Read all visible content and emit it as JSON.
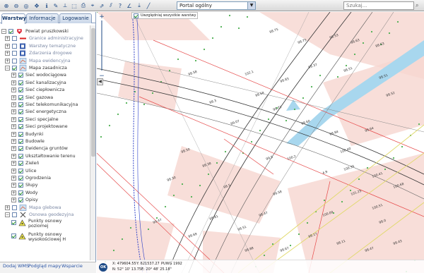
{
  "toolbar": {
    "icons": [
      "zoom-in-icon",
      "zoom-out-icon",
      "zoom-extent-icon",
      "pan-icon",
      "info-icon",
      "identify-icon",
      "measure-icon",
      "measure-area-icon",
      "print-icon",
      "pin-icon",
      "share-icon",
      "filter-icon",
      "question-icon",
      "angle-icon",
      "export-icon",
      "line-icon"
    ],
    "portal_select": "Portal ogólny",
    "search_placeholder": "Szukaj..."
  },
  "tabs": [
    "Warstwy",
    "Informacje",
    "Logowanie"
  ],
  "layers": {
    "root": "Powiat pruszkowski",
    "items": [
      {
        "label": "Granice administracyjne",
        "level": 1,
        "expand": "+",
        "checked": false,
        "dim": true,
        "icon": "red-line"
      },
      {
        "label": "Warstwy tematyczne",
        "level": 1,
        "expand": "+",
        "checked": false,
        "dim": true,
        "icon": "blue-box"
      },
      {
        "label": "Zdarzenia drogowe",
        "level": 1,
        "expand": "+",
        "checked": false,
        "dim": true,
        "icon": "blue-box"
      },
      {
        "label": "Mapa ewidencyjna",
        "level": 1,
        "expand": "+",
        "checked": false,
        "dim": true,
        "icon": "map"
      },
      {
        "label": "Mapa zasadnicza",
        "level": 1,
        "expand": "-",
        "checked": true,
        "dim": false,
        "icon": "map"
      },
      {
        "label": "Sieć wodociągowa",
        "level": 2,
        "expand": "+",
        "checked": true,
        "dim": false,
        "icon": ""
      },
      {
        "label": "Sieć kanalizacyjna",
        "level": 2,
        "expand": "+",
        "checked": true,
        "dim": false,
        "icon": ""
      },
      {
        "label": "Sieć ciepłownicza",
        "level": 2,
        "expand": "+",
        "checked": true,
        "dim": false,
        "icon": ""
      },
      {
        "label": "Sieć gazowa",
        "level": 2,
        "expand": "+",
        "checked": true,
        "dim": false,
        "icon": ""
      },
      {
        "label": "Sieć telekomunikacyjna",
        "level": 2,
        "expand": "+",
        "checked": true,
        "dim": false,
        "icon": ""
      },
      {
        "label": "Sieć energetyczna",
        "level": 2,
        "expand": "+",
        "checked": true,
        "dim": false,
        "icon": ""
      },
      {
        "label": "Sieci specjalne",
        "level": 2,
        "expand": "+",
        "checked": true,
        "dim": false,
        "icon": ""
      },
      {
        "label": "Sieci projektowane",
        "level": 2,
        "expand": "+",
        "checked": true,
        "dim": false,
        "icon": ""
      },
      {
        "label": "Budynki",
        "level": 2,
        "expand": "+",
        "checked": true,
        "dim": false,
        "icon": ""
      },
      {
        "label": "Budowle",
        "level": 2,
        "expand": "+",
        "checked": true,
        "dim": false,
        "icon": ""
      },
      {
        "label": "Ewidencja gruntów",
        "level": 2,
        "expand": "+",
        "checked": true,
        "dim": false,
        "icon": ""
      },
      {
        "label": "Ukształtowanie terenu",
        "level": 2,
        "expand": "+",
        "checked": true,
        "dim": false,
        "icon": ""
      },
      {
        "label": "Zieleń",
        "level": 2,
        "expand": "+",
        "checked": true,
        "dim": false,
        "icon": ""
      },
      {
        "label": "Ulice",
        "level": 2,
        "expand": "+",
        "checked": true,
        "dim": false,
        "icon": ""
      },
      {
        "label": "Ogrodzenia",
        "level": 2,
        "expand": "+",
        "checked": true,
        "dim": false,
        "icon": ""
      },
      {
        "label": "Słupy",
        "level": 2,
        "expand": "+",
        "checked": true,
        "dim": false,
        "icon": ""
      },
      {
        "label": "Wody",
        "level": 2,
        "expand": "+",
        "checked": true,
        "dim": false,
        "icon": ""
      },
      {
        "label": "Opisy",
        "level": 2,
        "expand": "+",
        "checked": true,
        "dim": false,
        "icon": ""
      },
      {
        "label": "Mapa glebowa",
        "level": 1,
        "expand": "+",
        "checked": false,
        "dim": true,
        "icon": "map"
      },
      {
        "label": "Osnowa geodezyjna",
        "level": 1,
        "expand": "-",
        "checked": false,
        "dim": true,
        "icon": "cross"
      }
    ],
    "osnowa_items": [
      "Punkty osnowy poziomej",
      "Punkty osnowy wysokościowej H"
    ]
  },
  "bottom_links": [
    "Dodaj WMS",
    "Podgląd mapy",
    "Wsparcie"
  ],
  "map": {
    "tooltip_checkbox": "Uwzględniaj wszystkie warstwy",
    "labels": [
      "98.75",
      "98.75",
      "98.53",
      "98.63",
      "98.63",
      "98.37",
      "98.51",
      "98.51",
      "98.52",
      "98.83",
      "98.68",
      "98.72",
      "98.60",
      "98.84",
      "98.64",
      "100.40",
      "100.35",
      "100.41",
      "100.68",
      "101.25",
      "100.51",
      "100.00",
      "99.58",
      "98.47",
      "98.51",
      "98.81",
      "98.69",
      "98.88",
      "98.67",
      "98.17",
      "98.11",
      "98.47",
      "98.43",
      "98.5",
      "98.38",
      "98.50",
      "98.30",
      "99.47",
      "99.07",
      "102.1",
      "98.3",
      "98.58",
      "4.9",
      "100.2",
      "99.5",
      "98.0"
    ]
  },
  "status": {
    "ok": "OK",
    "x": "X: 479604.55",
    "y": "Y: 621537.27",
    "crs": "PUWG 1992",
    "n": "N: 52° 10' 13.75\"",
    "e": "E: 20° 48' 25.18\""
  },
  "colors": {
    "map_pink": "#f6d6d0",
    "water": "#a8d7ee",
    "road_red": "#e64a4a",
    "blue_line": "#2b3fc8",
    "yellow_line": "#e0d96a",
    "green_dots": "#4caf50",
    "accent": "#1d4a86"
  }
}
